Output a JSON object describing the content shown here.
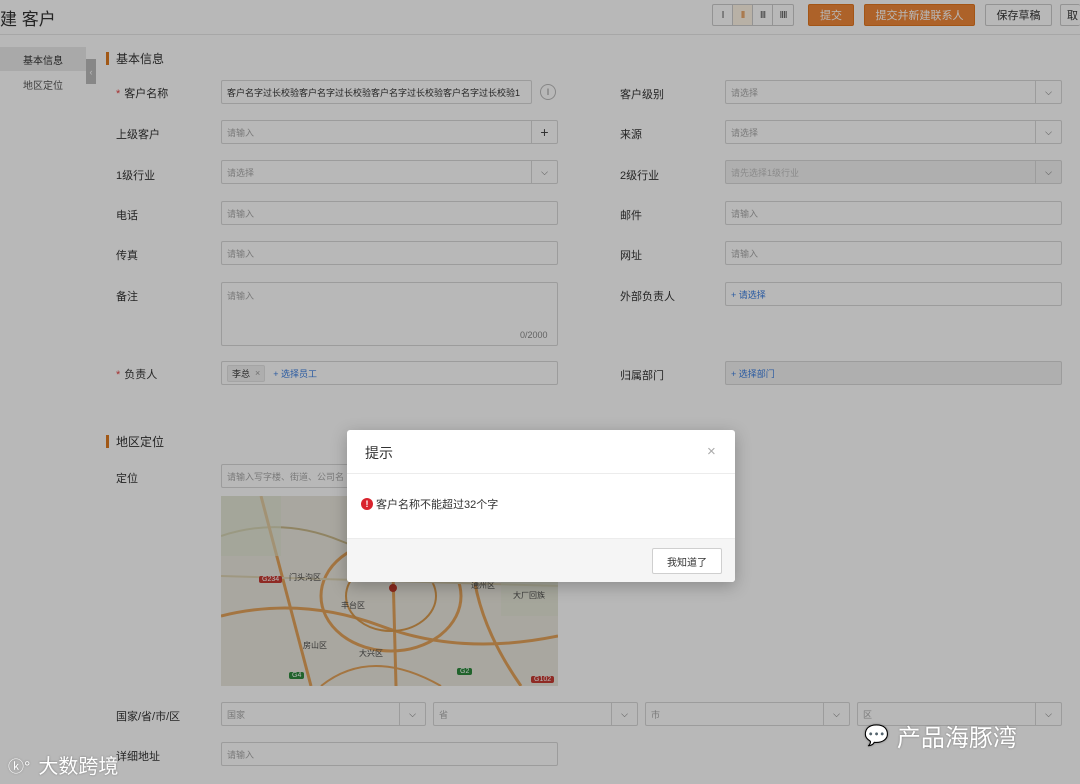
{
  "header": {
    "title": "建 客户",
    "view_options": [
      "I",
      "II",
      "III",
      "IIII"
    ],
    "submit_label": "提交",
    "submit_new_contact_label": "提交并新建联系人",
    "save_draft_label": "保存草稿",
    "cancel_label": "取"
  },
  "sidebar": {
    "items": [
      {
        "label": "基本信息",
        "active": true
      },
      {
        "label": "地区定位",
        "active": false
      }
    ],
    "collapse_icon": "‹"
  },
  "basic": {
    "section_title": "基本信息",
    "fields": {
      "customer_name": {
        "label": "客户名称",
        "required": true,
        "value": "客户名字过长校验客户名字过长校验客户名字过长校验客户名字过长校验1"
      },
      "customer_level": {
        "label": "客户级别",
        "placeholder": "请选择"
      },
      "parent_customer": {
        "label": "上级客户",
        "placeholder": "请输入"
      },
      "source": {
        "label": "来源",
        "placeholder": "请选择"
      },
      "industry1": {
        "label": "1级行业",
        "placeholder": "请选择"
      },
      "industry2": {
        "label": "2级行业",
        "placeholder": "请先选择1级行业"
      },
      "phone": {
        "label": "电话",
        "placeholder": "请输入"
      },
      "email": {
        "label": "邮件",
        "placeholder": "请输入"
      },
      "fax": {
        "label": "传真",
        "placeholder": "请输入"
      },
      "website": {
        "label": "网址",
        "placeholder": "请输入"
      },
      "remark": {
        "label": "备注",
        "placeholder": "请输入",
        "counter": "0/2000"
      },
      "external_owner": {
        "label": "外部负责人",
        "link": "+ 请选择"
      },
      "owner": {
        "label": "负责人",
        "required": true,
        "tag": "李总",
        "link": "+ 选择员工"
      },
      "department": {
        "label": "归属部门",
        "link": "+ 选择部门"
      }
    }
  },
  "region": {
    "section_title": "地区定位",
    "location_label": "定位",
    "location_placeholder": "请输入写字楼、街道、公司名",
    "map": {
      "labels": [
        "门头沟区",
        "丰台区",
        "房山区",
        "大兴区",
        "通州区",
        "大厂回族"
      ],
      "shields": [
        "G234",
        "G4",
        "G2",
        "G102"
      ]
    },
    "country_label": "国家/省/市/区",
    "country_placeholder": "国家",
    "province_placeholder": "省",
    "city_placeholder": "市",
    "district_placeholder": "区",
    "address_label": "详细地址",
    "address_placeholder": "请输入"
  },
  "dialog": {
    "title": "提示",
    "close_icon": "×",
    "error_icon": "!",
    "message": "客户名称不能超过32个字",
    "confirm_label": "我知道了"
  },
  "watermarks": {
    "left": "大数跨境",
    "right": "产品海豚湾"
  },
  "colors": {
    "accent": "#f0883a",
    "link": "#3a7de0",
    "error": "#d9232d"
  }
}
